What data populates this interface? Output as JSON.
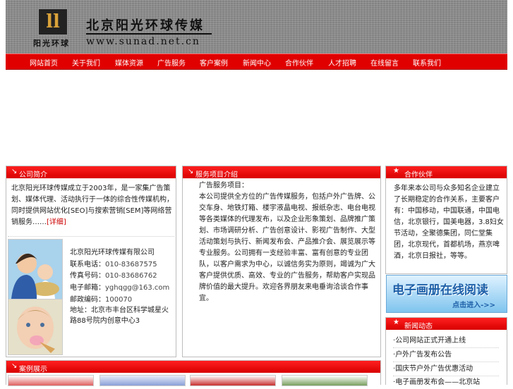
{
  "header": {
    "logo_mark": "ll",
    "logo_caption": "阳光环球",
    "brand_title": "北京阳光环球传媒",
    "brand_url": "www.sunad.net.cn"
  },
  "nav": {
    "items": [
      "网站首页",
      "关于我们",
      "媒体资源",
      "广告服务",
      "客户案例",
      "新闻中心",
      "合作伙伴",
      "人才招聘",
      "在线留言",
      "联系我们"
    ]
  },
  "company_intro": {
    "title": "公司简介",
    "body": "北京阳光环球传媒成立于2003年，是一家集广告策划、媒体代理、活动执行于一体的综合性传媒机构，同时提供网站优化[SEO]与搜索营销[SEM]等网络营销服务……",
    "more_label": "[详细]",
    "contact": {
      "company": "北京阳光环球传媒有限公司",
      "phone_label": "联系电话：",
      "phone": "010-83687575",
      "fax_label": "传真号码：",
      "fax": "010-83686762",
      "email_label": "电子邮箱：",
      "email": "yghqgg@163.com",
      "zip_label": "邮政编码：",
      "zip": "100070",
      "address": "地址：北京市丰台区科学城星火路88号院内创意中心3"
    }
  },
  "service": {
    "title": "服务项目介绍",
    "heading": "广告服务项目：",
    "body": "本公司提供全方位的广告传媒服务，包括户外广告牌、公交车身、地铁灯箱、楼宇液晶电视、报纸杂志、电台电视等各类媒体的代理发布，以及企业形象策划、品牌推广策划、市场调研分析、广告创意设计、影视广告制作、大型活动策划与执行、新闻发布会、产品推介会、展览展示等专业服务。公司拥有一支经验丰富、富有创意的专业团队，以客户需求为中心，以诚信务实为原则，竭诚为广大客户提供优质、高效、专业的广告服务，帮助客户实现品牌价值的最大提升。欢迎各界朋友来电垂询洽谈合作事宜。"
  },
  "partners": {
    "title": "合作伙伴",
    "body": "多年来本公司与众多知名企业建立了长期稳定的合作关系，主要客户有：中国移动，中国联通，中国电信，北京银行，国美电器，3.8妇女节活动，全聚德集团，同仁堂集团，北京现代，首都机场，燕京啤酒，北京日报社，等等。"
  },
  "ebook_banner": {
    "main": "电子画册在线阅读",
    "sub": "点击进入->>"
  },
  "news": {
    "title": "新闻动态",
    "items": [
      "公司网站正式开通上线",
      "户外广告发布公告",
      "国庆节户外广告优惠活动",
      "电子画册发布会——北京站"
    ]
  },
  "cases": {
    "title": "案例展示"
  },
  "colors": {
    "brand_red": "#e00000",
    "header_gray": "#8a8a8a",
    "banner_blue": "#1d5fa8"
  },
  "icons": {
    "panel_head_left": "arrow-corner-icon",
    "panel_head_right": "star-icon"
  }
}
